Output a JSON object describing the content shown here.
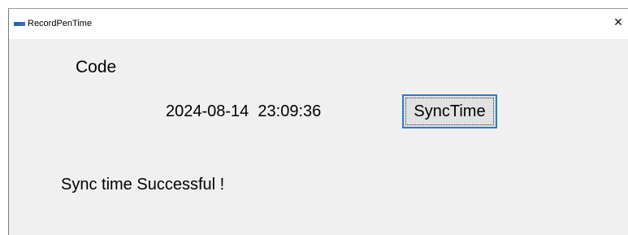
{
  "window": {
    "title": "RecordPenTime",
    "close_glyph": "✕",
    "icon": "philips-app-icon"
  },
  "main": {
    "code_label": "Code",
    "datetime": "2024-08-14  23:09:36",
    "sync_button_label": "SyncTime",
    "status_message": "Sync time Successful !"
  },
  "colors": {
    "window_bg": "#f0f0f0",
    "titlebar_bg": "#ffffff",
    "button_bg": "#e1e1e1",
    "button_focus_border": "#2b79d6"
  }
}
